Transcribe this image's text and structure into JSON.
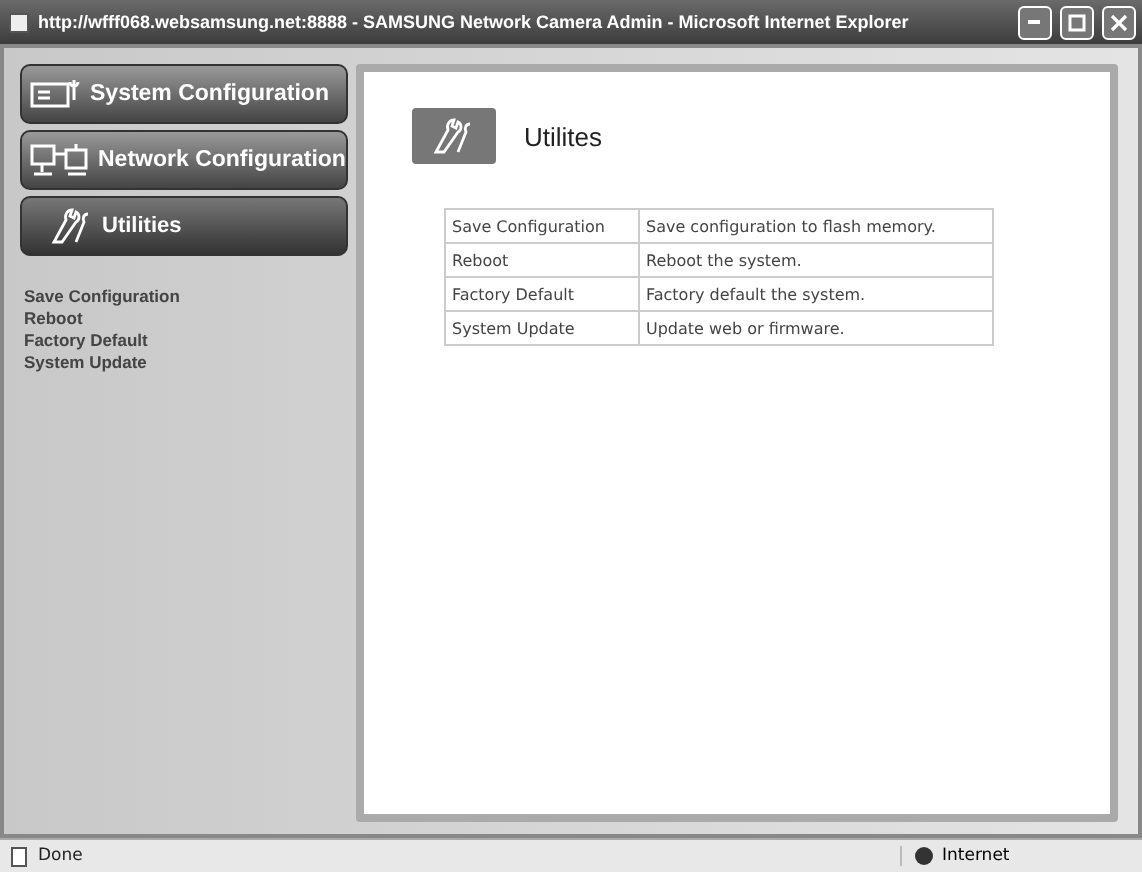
{
  "window": {
    "title": "http://wfff068.websamsung.net:8888 - SAMSUNG Network Camera Admin - Microsoft Internet Explorer"
  },
  "sidebar": {
    "menu": [
      {
        "label": "System Configuration",
        "kind": "system",
        "selected": false
      },
      {
        "label": "Network Configuration",
        "kind": "network",
        "selected": false
      },
      {
        "label": "Utilities",
        "kind": "tools",
        "selected": true
      }
    ],
    "links": [
      "Save Configuration",
      "Reboot",
      "Factory Default",
      "System Update"
    ]
  },
  "main": {
    "heading": "Utilites",
    "table": {
      "rows": [
        [
          "Save Configuration",
          "Save configuration to flash memory."
        ],
        [
          "Reboot",
          "Reboot the system."
        ],
        [
          "Factory Default",
          "Factory default the system."
        ],
        [
          "System Update",
          "Update web or firmware."
        ]
      ]
    }
  },
  "status_bar": {
    "status": "Done",
    "zone": "Internet"
  }
}
